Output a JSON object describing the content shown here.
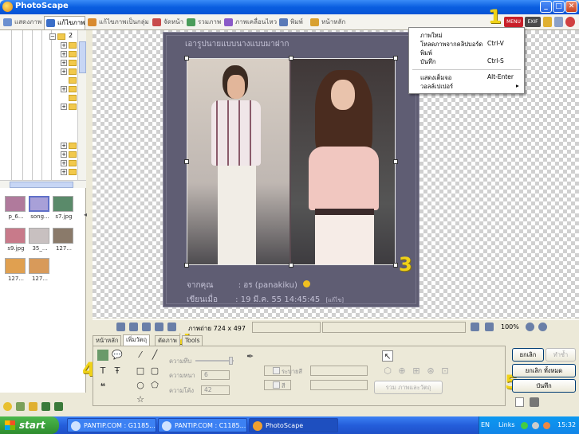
{
  "window": {
    "title": "PhotoScape",
    "minimize": "_",
    "maximize": "□",
    "close": "✕"
  },
  "tabs": [
    {
      "label": "แสดงภาพ",
      "color": "#6a8fd0"
    },
    {
      "label": "แก้ไขภาพ",
      "color": "#3a6ec8"
    },
    {
      "label": "แก้ไขภาพเป็นกลุ่ม",
      "color": "#d88a30"
    },
    {
      "label": "จัดหน้า",
      "color": "#c84a4a"
    },
    {
      "label": "รวมภาพ",
      "color": "#4a9c5a"
    },
    {
      "label": "ภาพเคลื่อนไหว",
      "color": "#8a5ac8"
    },
    {
      "label": "พิมพ์",
      "color": "#5a7ab8"
    },
    {
      "label": "หน้าหลัก",
      "color": "#d8a030"
    }
  ],
  "toolbar_right": {
    "menu": "MENU",
    "exif": "EXIF"
  },
  "tree": {
    "root_label": "2"
  },
  "thumbnails": [
    {
      "name": "p_6...",
      "color": "#b07a9c"
    },
    {
      "name": "song...",
      "color": "#a8a0d8"
    },
    {
      "name": "s7.jpg",
      "color": "#5a8a6a"
    },
    {
      "name": "s9.jpg",
      "color": "#c87a8a"
    },
    {
      "name": "35_...",
      "color": "#c8c0c0"
    },
    {
      "name": "127...",
      "color": "#8a7a6a"
    },
    {
      "name": "127...",
      "color": "#e0a050"
    },
    {
      "name": "127...",
      "color": "#d89a5a"
    }
  ],
  "canvas": {
    "frame_title": "เอารูปนายแบบนางแบบมาฝาก",
    "line1_label": "จากคุณ",
    "line1_value": ": อร (panakiku)",
    "line2_label": "เขียนเมื่อ",
    "line2_value": ": 19 มี.ค. 55 14:45:45",
    "line2_suffix": "[แก้ไข]"
  },
  "menu": {
    "items": [
      {
        "label": "ภาพใหม่",
        "shortcut": ""
      },
      {
        "label": "โหลดภาพจากคลิปบอร์ด",
        "shortcut": "Ctrl-V"
      },
      {
        "label": "พิมพ์",
        "shortcut": ""
      },
      {
        "label": "บันทึก",
        "shortcut": "Ctrl-S"
      },
      {
        "label": "แสดงเต็มจอ",
        "shortcut": "Alt-Enter"
      },
      {
        "label": "วอลล์เปเปอร์",
        "shortcut": "▸"
      }
    ]
  },
  "annotations": [
    "1",
    "2",
    "3",
    "4",
    "5"
  ],
  "status": {
    "image_size": "ภาพถ่าย 724 x 497",
    "zoom": "100%"
  },
  "object_tabs": [
    "หน้าหลัก",
    "เพิ่มวัตถุ",
    "ตัดภาพ",
    "Tools"
  ],
  "object_panel": {
    "transparency": "ความทึบ",
    "thickness": "ความหนา",
    "thickness_value": "6",
    "round": "ความโค้ง",
    "round_value": "42",
    "fill_label": "ระบายสี",
    "color_label": "สี",
    "merge_button": "รวม ภาพและวัตถุ"
  },
  "right_buttons": {
    "undo": "ยกเลิก",
    "redo": "ทำซ้ำ",
    "undo_all": "ยกเลิก ทั้งหมด",
    "save": "บันทึก"
  },
  "taskbar": {
    "start": "start",
    "tasks": [
      "PANTIP.COM : G1185...",
      "PANTIP.COM : C1185...",
      "PhotoScape"
    ],
    "lang": "EN",
    "links": "Links",
    "time": "15:32"
  }
}
